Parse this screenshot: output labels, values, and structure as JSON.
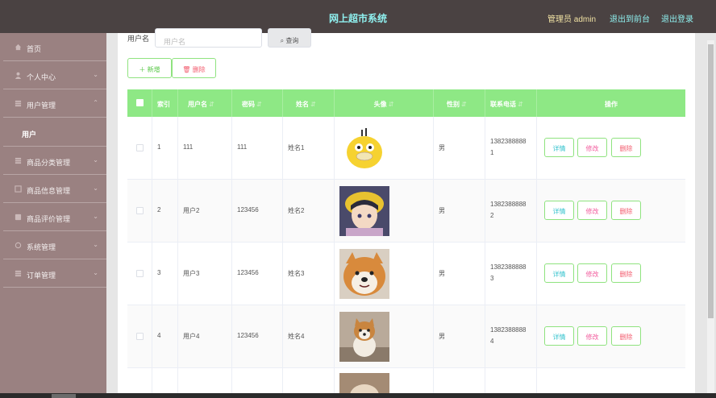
{
  "header": {
    "title": "网上超市系统",
    "admin_label": "管理员 admin",
    "front_link": "退出到前台",
    "logout_link": "退出登录"
  },
  "sidebar": {
    "items": [
      {
        "label": "首页",
        "icon": "home-icon"
      },
      {
        "label": "个人中心",
        "icon": "user-icon"
      },
      {
        "label": "用户管理",
        "icon": "users-icon"
      },
      {
        "label": "商品分类管理",
        "icon": "category-icon"
      },
      {
        "label": "商品信息管理",
        "icon": "goods-icon"
      },
      {
        "label": "商品评价管理",
        "icon": "review-icon"
      },
      {
        "label": "系统管理",
        "icon": "settings-icon"
      },
      {
        "label": "订单管理",
        "icon": "order-icon"
      }
    ],
    "active_sub": "用户"
  },
  "search": {
    "label": "用户名",
    "placeholder": "用户名",
    "button": "查询"
  },
  "actions": {
    "add": "新增",
    "delete": "删除"
  },
  "table": {
    "headers": [
      "索引",
      "用户名",
      "密码",
      "姓名",
      "头像",
      "性别",
      "联系电话",
      "操作"
    ],
    "rows": [
      {
        "index": "1",
        "username": "111",
        "password": "111",
        "name": "姓名1",
        "gender": "男",
        "phone_a": "1382388888",
        "phone_b": "1",
        "avatar": "psyduck"
      },
      {
        "index": "2",
        "username": "用户2",
        "password": "123456",
        "name": "姓名2",
        "gender": "男",
        "phone_a": "1382388888",
        "phone_b": "2",
        "avatar": "anime"
      },
      {
        "index": "3",
        "username": "用户3",
        "password": "123456",
        "name": "姓名3",
        "gender": "男",
        "phone_a": "1382388888",
        "phone_b": "3",
        "avatar": "shiba"
      },
      {
        "index": "4",
        "username": "用户4",
        "password": "123456",
        "name": "姓名4",
        "gender": "男",
        "phone_a": "1382388888",
        "phone_b": "4",
        "avatar": "puppy"
      }
    ],
    "row_actions": {
      "detail": "详情",
      "edit": "修改",
      "delete": "删除"
    }
  },
  "colors": {
    "header_bg": "#4a4242",
    "header_title": "#8ff0ef",
    "sidebar_bg": "#9a8181",
    "table_header": "#8ee885",
    "button_border": "#8fe37f"
  }
}
